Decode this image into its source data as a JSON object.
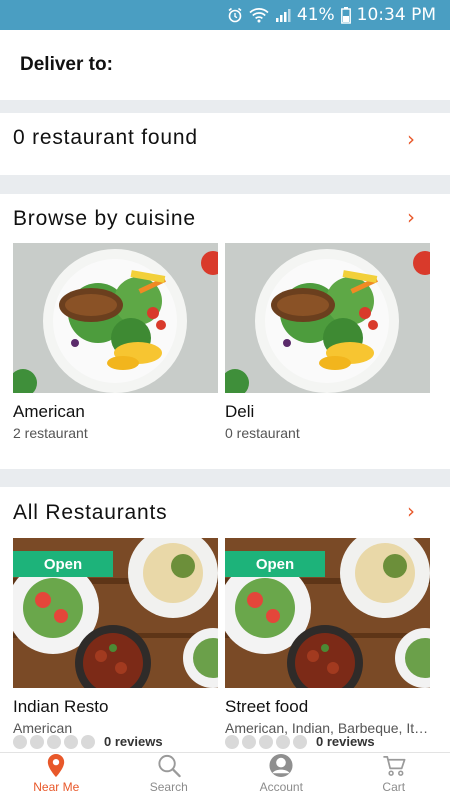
{
  "status_bar": {
    "battery": "41%",
    "time": "10:34 PM",
    "icons": [
      "alarm-icon",
      "wifi-icon",
      "signal-icon",
      "battery-icon"
    ]
  },
  "deliver": {
    "label": "Deliver to:"
  },
  "found": {
    "text": "0 restaurant found"
  },
  "cuisine": {
    "title": "Browse by cuisine",
    "items": [
      {
        "name": "American",
        "count": "2 restaurant"
      },
      {
        "name": "Deli",
        "count": "0 restaurant"
      }
    ]
  },
  "all_restaurants": {
    "title": "All Restaurants",
    "items": [
      {
        "badge": "Open",
        "name": "Indian Resto",
        "cuisines": "American",
        "reviews": "0 reviews"
      },
      {
        "badge": "Open",
        "name": "Street food",
        "cuisines": "American, Indian, Barbeque, Italian",
        "reviews": "0 reviews"
      }
    ]
  },
  "nav": {
    "items": [
      {
        "label": "Near Me",
        "icon": "location-pin-icon",
        "active": true
      },
      {
        "label": "Search",
        "icon": "search-icon",
        "active": false
      },
      {
        "label": "Account",
        "icon": "account-icon",
        "active": false
      },
      {
        "label": "Cart",
        "icon": "cart-icon",
        "active": false
      }
    ]
  },
  "colors": {
    "accent": "#e8582a",
    "status_bar": "#4a9ec2",
    "open_badge": "#1db37a"
  }
}
